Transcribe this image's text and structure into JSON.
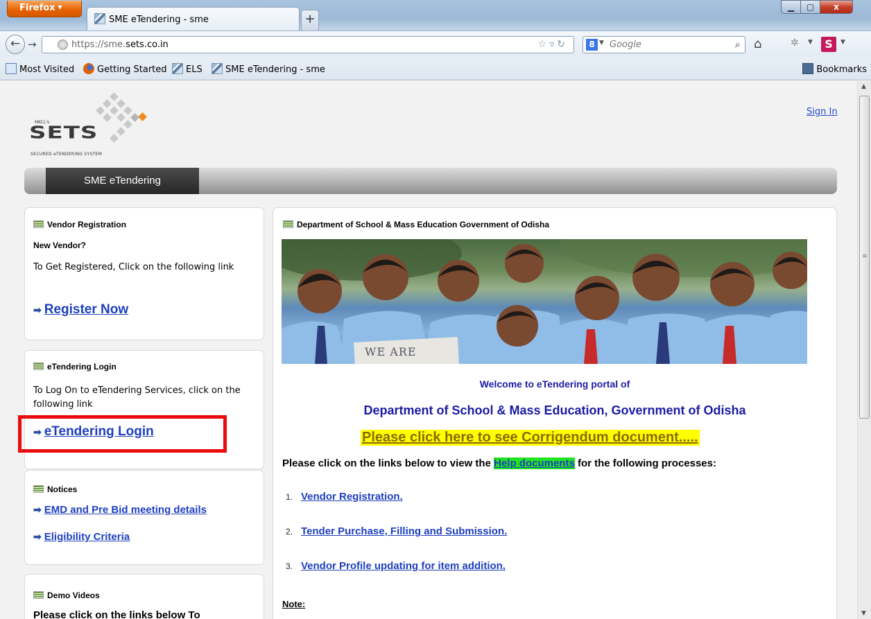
{
  "browser": {
    "menu_label": "Firefox",
    "tab_title": "SME eTendering - sme",
    "new_tab": "+",
    "url_prefix": "https://sme.",
    "url_domain": "sets.co.in",
    "search_placeholder": "Google",
    "search_engine_badge": "8",
    "addon_badge": "S",
    "bookmarks": [
      {
        "label": "Most Visited",
        "icon": "most-visited-icon"
      },
      {
        "label": "Getting Started",
        "icon": "firefox-icon"
      },
      {
        "label": "ELS",
        "icon": "page-favicon"
      },
      {
        "label": "SME eTendering - sme",
        "icon": "page-favicon"
      }
    ],
    "bookmarks_menu": "Bookmarks"
  },
  "header": {
    "logo_small": "MKCL's",
    "logo_text": "SETS",
    "logo_tagline": "SECURED eTENDERING SYSTEM",
    "sign_in": "Sign In"
  },
  "nav": {
    "tab_label": "SME eTendering"
  },
  "vendor_registration": {
    "heading": "Vendor Registration",
    "subheading": "New Vendor?",
    "text": "To Get Registered, Click on the following link",
    "link": "Register Now"
  },
  "etendering_login": {
    "heading": "eTendering Login",
    "text": "To Log On to eTendering Services, click on the following link",
    "link": "eTendering Login"
  },
  "notices": {
    "heading": "Notices",
    "links": [
      "EMD and Pre Bid meeting details",
      "Eligibility Criteria"
    ]
  },
  "demo_videos": {
    "heading": "Demo Videos",
    "text": "Please click on the links below To"
  },
  "main": {
    "heading": "Department of School & Mass Education Government of Odisha",
    "banner_sign": "WE ARE",
    "welcome_line1": "Welcome to eTendering portal of",
    "welcome_line2": "Department of School & Mass Education, Government of Odisha",
    "corrigendum": "Please click here to see Corrigendum document.....",
    "instructions_before": "Please click on the links below to view the ",
    "help_link": "Help documents",
    "instructions_after": " for the following processes:",
    "help_items": [
      {
        "num": "1.",
        "label": "Vendor Registration."
      },
      {
        "num": "2.",
        "label": "Tender Purchase, Filling and Submission."
      },
      {
        "num": "3.",
        "label": "Vendor Profile updating for item addition."
      }
    ],
    "note": "Note:"
  },
  "colors": {
    "highlight_box": "#ea0b0b",
    "link": "#1d3fbf",
    "welcome_text": "#1a1aa5",
    "corrigendum_bg": "#ffff00",
    "help_bg": "#22e322"
  }
}
